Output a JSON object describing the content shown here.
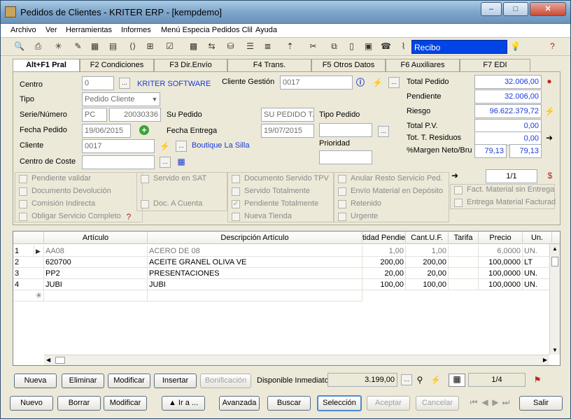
{
  "window": {
    "title": "Pedidos de Clientes - KRITER ERP - [kempdemo]",
    "min": "–",
    "max": "□",
    "close": "✕"
  },
  "menu": [
    "Archivo",
    "Ver",
    "Herramientas",
    "Informes",
    "Menú Especia Pedidos Clil",
    "Ayuda"
  ],
  "toolbar": {
    "recibo": "Recibo"
  },
  "tabs": [
    "Alt+F1 Pral",
    "F2 Condiciones",
    "F3 Dir.Envío",
    "F4 Trans.",
    "F5 Otros Datos",
    "F6 Auxiliares",
    "F7 EDI"
  ],
  "form": {
    "centro_label": "Centro",
    "centro_value": "0",
    "centro_name": "KRITER SOFTWARE",
    "cliente_gestion_label": "Cliente Gestión",
    "cliente_gestion_value": "0017",
    "tipo_label": "Tipo",
    "tipo_value": "Pedido Cliente",
    "serie_label": "Serie/Número",
    "serie_value": "PC",
    "numero_value": "20030336",
    "su_pedido_label": "Su Pedido",
    "su_pedido_value": "SU PEDIDO T.",
    "tipo_pedido_label": "Tipo Pedido",
    "fecha_pedido_label": "Fecha Pedido",
    "fecha_pedido_value": "19/06/2015",
    "fecha_entrega_label": "Fecha Entrega",
    "fecha_entrega_value": "19/07/2015",
    "prioridad_label": "Prioridad",
    "cliente_label": "Cliente",
    "cliente_value": "0017",
    "cliente_name": "Boutique La Silla",
    "centro_coste_label": "Centro de Coste",
    "centro_coste_value": ""
  },
  "totals": {
    "total_pedido_label": "Total Pedido",
    "total_pedido": "32.006,00",
    "pendiente_label": "Pendiente",
    "pendiente": "32.006,00",
    "riesgo_label": "Riesgo",
    "riesgo": "96.622.379,72",
    "total_pv_label": "Total P.V.",
    "total_pv": "0,00",
    "residuos_label": "Tot. T. Residuos",
    "residuos": "0,00",
    "margen_label": "%Margen Neto/Bru",
    "margen_neto": "79,13",
    "margen_bruto": "79,13",
    "pager": "1/1"
  },
  "checks": [
    "Pendiente validar",
    "Documento Devolución",
    "Comisión Indirecta",
    "Obligar Servicio Completo",
    "Servido en SAT",
    "Doc. A Cuenta",
    "Documento Servido TPV",
    "Servido Totalmente",
    "Pendiente Totalmente",
    "Nueva Tienda",
    "Anular Resto Servicio Ped.",
    "Envío Material en Depósito",
    "Retenido",
    "Urgente",
    "Fact. Material sin Entrega",
    "Entrega Material Facturad"
  ],
  "grid": {
    "headers": [
      "Artículo",
      "Descripción Artículo",
      "tidad Pendie",
      "Cant.U.F.",
      "Tarifa",
      "Precio",
      "Un."
    ],
    "rows": [
      {
        "n": "1",
        "art": "AA08",
        "desc": "ACERO DE 08",
        "pend": "1,00",
        "cuf": "1,00",
        "tarifa": "",
        "precio": "6,0000",
        "un": "UN."
      },
      {
        "n": "2",
        "art": "620700",
        "desc": "ACEITE GRANEL OLIVA VE",
        "pend": "200,00",
        "cuf": "200,00",
        "tarifa": "",
        "precio": "100,0000",
        "un": "LT"
      },
      {
        "n": "3",
        "art": "PP2",
        "desc": "PRESENTACIONES",
        "pend": "20,00",
        "cuf": "20,00",
        "tarifa": "",
        "precio": "100,0000",
        "un": "UN."
      },
      {
        "n": "4",
        "art": "JUBI",
        "desc": "JUBI",
        "pend": "100,00",
        "cuf": "100,00",
        "tarifa": "",
        "precio": "100,0000",
        "un": "UN."
      }
    ]
  },
  "line_buttons": {
    "nueva": "Nueva",
    "eliminar": "Eliminar",
    "modificar": "Modificar",
    "insertar": "Insertar",
    "bonificacion": "Bonificación",
    "disponible_label": "Disponible Inmediato",
    "disponible_value": "3.199,00",
    "pager": "1/4"
  },
  "bottom_buttons": {
    "nuevo": "Nuevo",
    "borrar": "Borrar",
    "modificar": "Modificar",
    "ir_a": "▲ Ir a ...",
    "avanzada": "Avanzada",
    "buscar": "Buscar",
    "seleccion": "Selección",
    "aceptar": "Aceptar",
    "cancelar": "Cancelar",
    "salir": "Salir"
  }
}
